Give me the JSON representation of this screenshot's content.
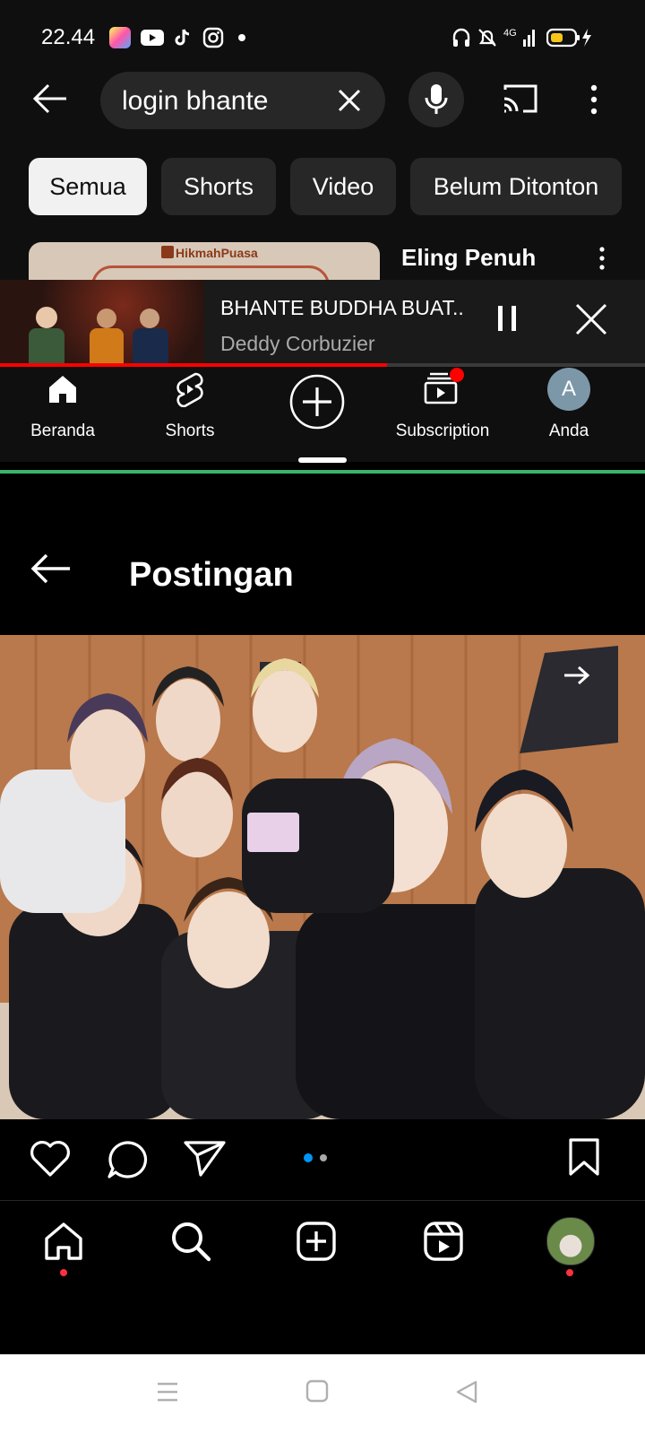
{
  "status_bar": {
    "time": "22.44",
    "battery_color": "#f5c518"
  },
  "youtube": {
    "search_query": "login bhante",
    "chips": [
      "Semua",
      "Shorts",
      "Video",
      "Belum Ditonton"
    ],
    "result_title": "Eling Penuh",
    "thumbnail_brand": "HikmahPuasa",
    "mini_player": {
      "title": "BHANTE BUDDHA BUAT..",
      "channel": "Deddy Corbuzier",
      "progress": 0.6
    },
    "nav": {
      "home": "Beranda",
      "shorts": "Shorts",
      "subscription": "Subscription",
      "you": "Anda",
      "avatar_letter": "A"
    },
    "accent": "#ff0000"
  },
  "instagram": {
    "header_title": "Postingan",
    "carousel": {
      "total": 2,
      "active": 1
    }
  }
}
